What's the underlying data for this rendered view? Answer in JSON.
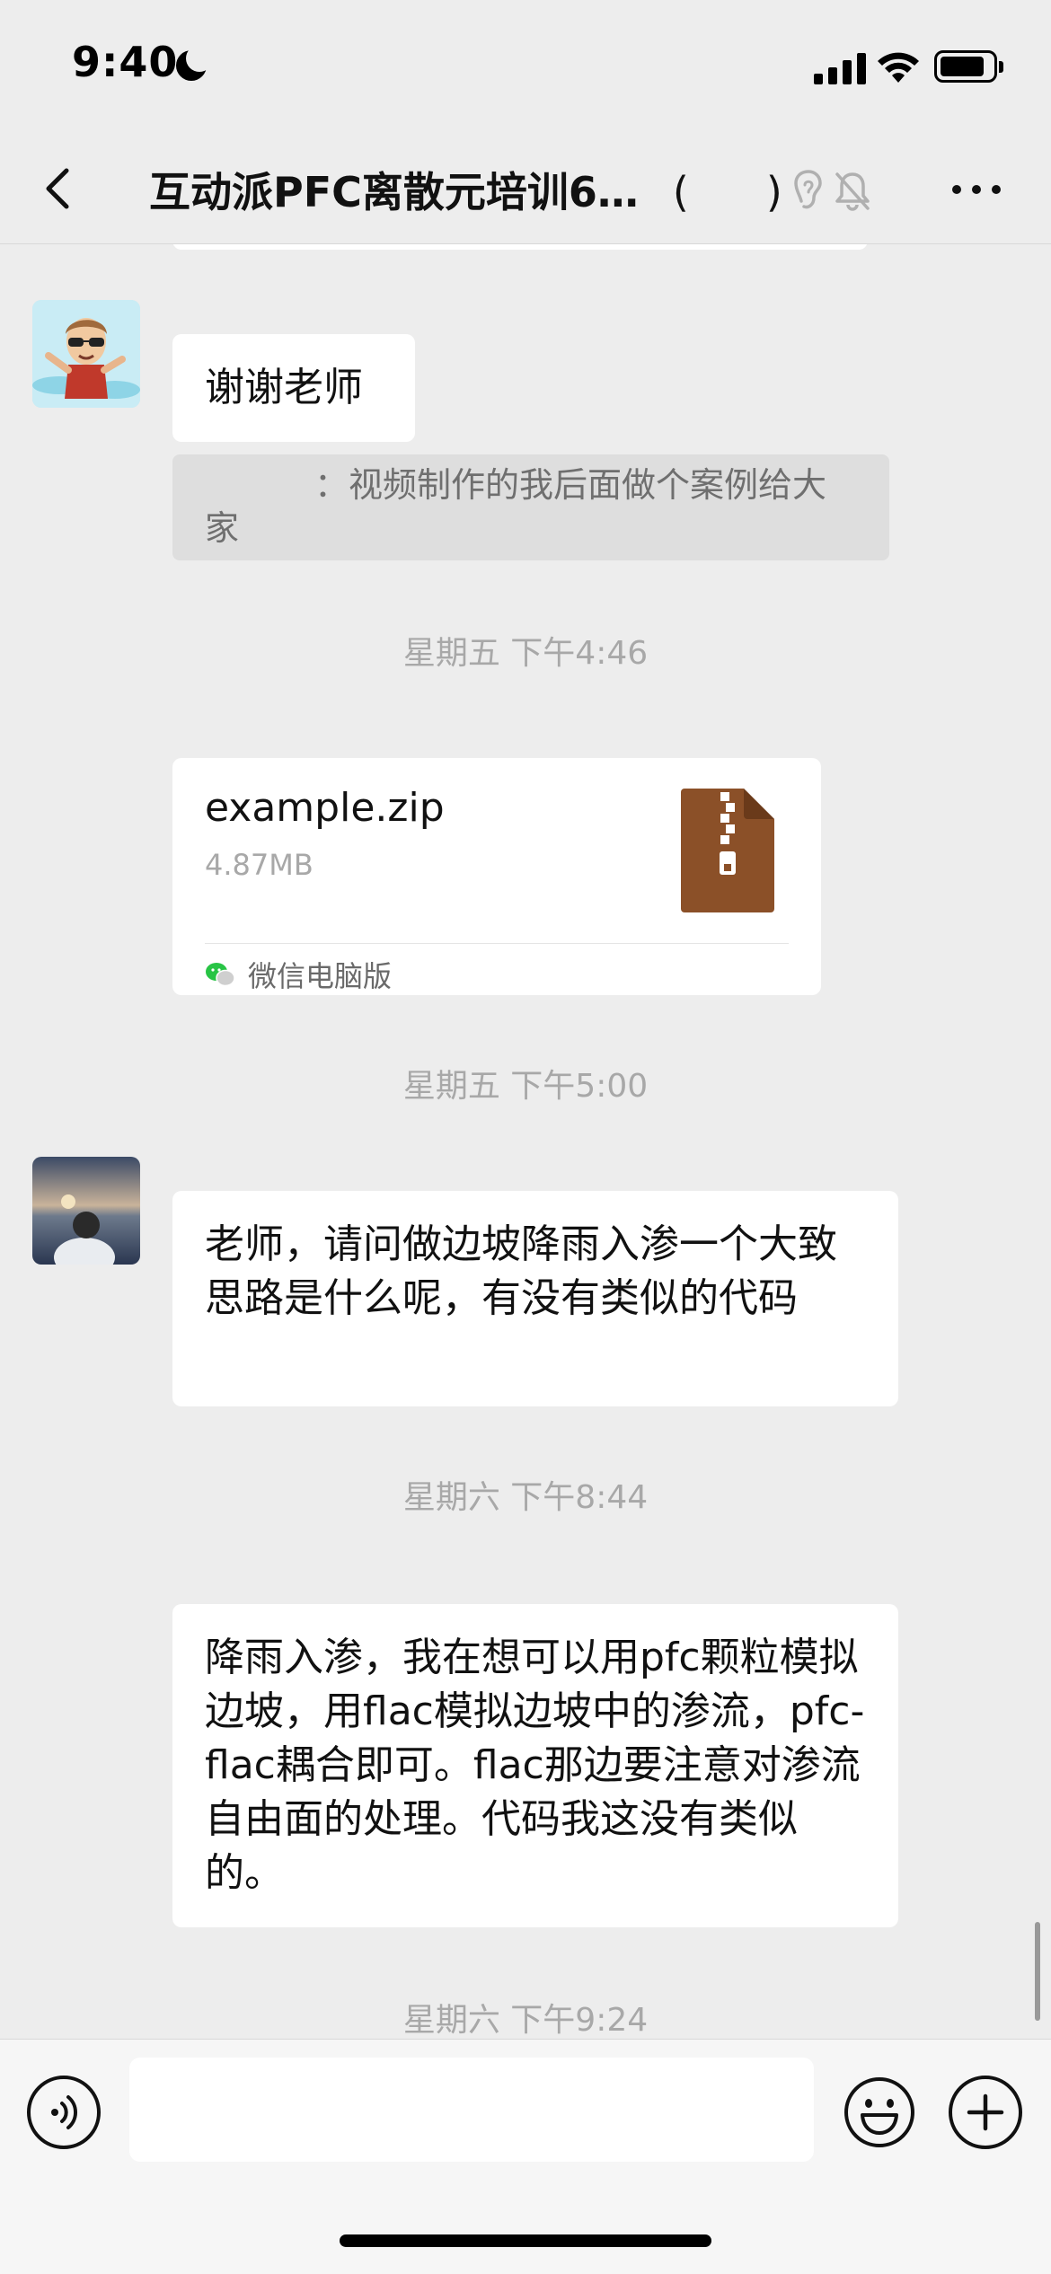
{
  "status_bar": {
    "time": "9:40"
  },
  "nav": {
    "title": "互动派PFC离散元培训6…",
    "paren_open": "(",
    "paren_close": ")"
  },
  "messages": {
    "m1_text": "谢谢老师",
    "m1_quote_sep": "：",
    "m1_quote": "视频制作的我后面做个案例给大家",
    "time1": "星期五 下午4:46",
    "file_name": "example.zip",
    "file_size": "4.87MB",
    "file_source": "微信电脑版",
    "time2": "星期五 下午5:00",
    "m2_text": "老师，请问做边坡降雨入渗一个大致思路是什么呢，有没有类似的代码",
    "time3": "星期六 下午8:44",
    "m3_text": "降雨入渗，我在想可以用pfc颗粒模拟边坡，用flac模拟边坡中的渗流，pfc-flac耦合即可。flac那边要注意对渗流自由面的处理。代码我这没有类似的。",
    "time4": "星期六 下午9:24"
  },
  "input": {
    "value": "",
    "placeholder": ""
  },
  "icons": {
    "back": "chevron-left-icon",
    "ear": "ear-icon",
    "mute": "bell-slash-icon",
    "more": "ellipsis-icon",
    "zip": "zip-file-icon",
    "wechat": "wechat-icon",
    "voice": "voice-icon",
    "emoji": "emoji-icon",
    "plus": "plus-icon"
  },
  "colors": {
    "background": "#ededed",
    "bubble": "#ffffff",
    "zip_icon": "#8b5028",
    "timestamp": "#a8a8a8",
    "wechat_green": "#28c445"
  }
}
